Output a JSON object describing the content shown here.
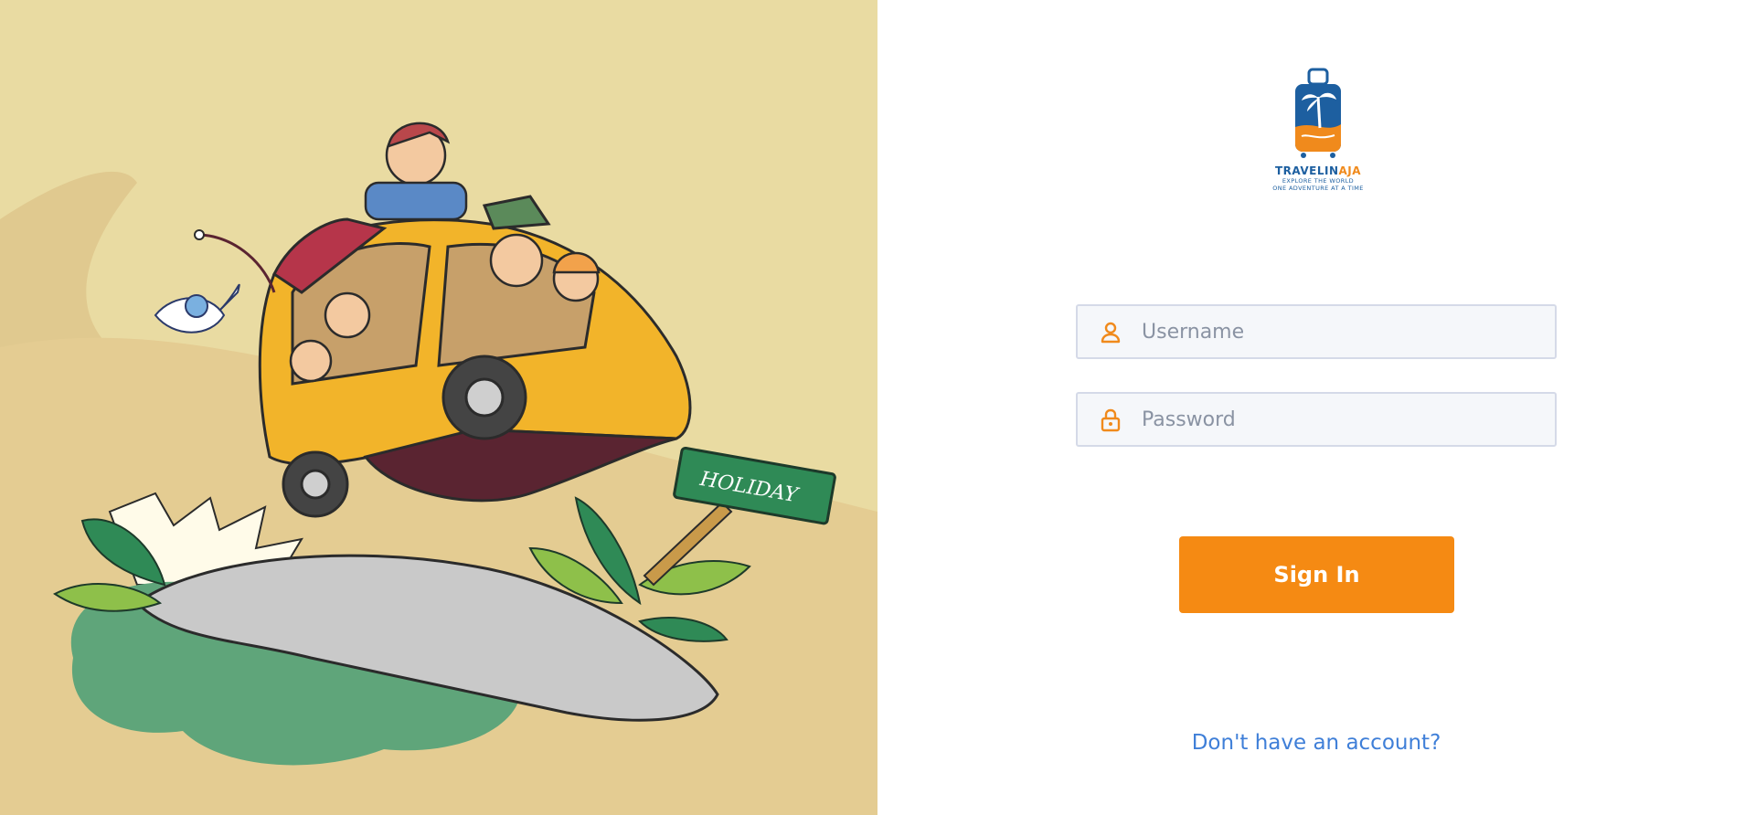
{
  "illustration": {
    "sign_text": "HOLIDAY"
  },
  "logo": {
    "brand_part1": "TRAVELIN",
    "brand_part2": "AJA",
    "tagline_line1": "EXPLORE THE WORLD",
    "tagline_line2": "ONE ADVENTURE AT A TIME"
  },
  "form": {
    "username_placeholder": "Username",
    "username_icon": "user-icon",
    "password_placeholder": "Password",
    "password_icon": "lock-icon",
    "signin_label": "Sign In",
    "signup_link": "Don't have an account?"
  },
  "colors": {
    "accent": "#f58a13",
    "link": "#3f7fd8",
    "brand_blue": "#1d5fa0"
  }
}
